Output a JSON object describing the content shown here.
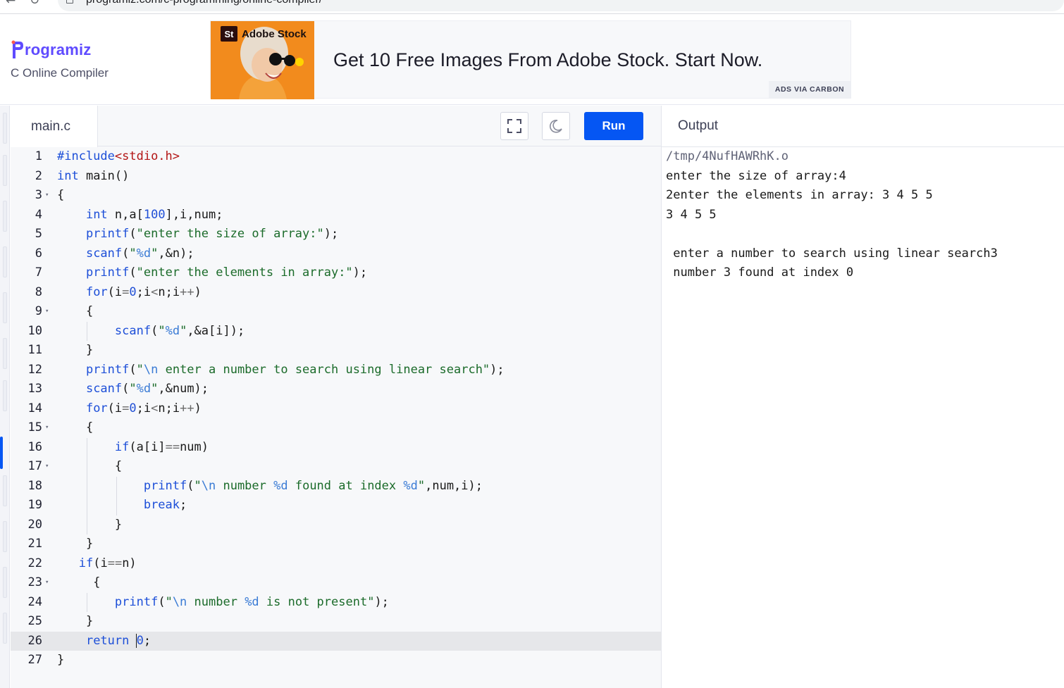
{
  "browser": {
    "url": "programiz.com/c-programming/online-compiler/"
  },
  "header": {
    "logo_text": "rogramiz",
    "subtitle": "C Online Compiler",
    "brand_color": "#5f4bff"
  },
  "ad": {
    "brand_badge": "St",
    "brand_name": "Adobe Stock",
    "headline": "Get 10 Free Images From Adobe Stock. Start Now.",
    "tag": "ADS VIA CARBON"
  },
  "editor": {
    "tab_label": "main.c",
    "fullscreen_icon": "fullscreen-icon",
    "theme_icon": "moon-icon",
    "run_label": "Run",
    "run_color": "#0556f3",
    "active_line": 26,
    "lines": [
      {
        "n": "1",
        "text": "#include<stdio.h>"
      },
      {
        "n": "2",
        "text": "int main()"
      },
      {
        "n": "3",
        "text": "{"
      },
      {
        "n": "4",
        "text": "    int n,a[100],i,num;"
      },
      {
        "n": "5",
        "text": "    printf(\"enter the size of array:\");"
      },
      {
        "n": "6",
        "text": "    scanf(\"%d\",&n);"
      },
      {
        "n": "7",
        "text": "    printf(\"enter the elements in array:\");"
      },
      {
        "n": "8",
        "text": "    for(i=0;i<n;i++)"
      },
      {
        "n": "9",
        "text": "    {"
      },
      {
        "n": "10",
        "text": "        scanf(\"%d\",&a[i]);"
      },
      {
        "n": "11",
        "text": "    }"
      },
      {
        "n": "12",
        "text": "    printf(\"\\n enter a number to search using linear search\");"
      },
      {
        "n": "13",
        "text": "    scanf(\"%d\",&num);"
      },
      {
        "n": "14",
        "text": "    for(i=0;i<n;i++)"
      },
      {
        "n": "15",
        "text": "    {"
      },
      {
        "n": "16",
        "text": "        if(a[i]==num)"
      },
      {
        "n": "17",
        "text": "        {"
      },
      {
        "n": "18",
        "text": "            printf(\"\\n number %d found at index %d\",num,i);"
      },
      {
        "n": "19",
        "text": "            break;"
      },
      {
        "n": "20",
        "text": "        }"
      },
      {
        "n": "21",
        "text": "    }"
      },
      {
        "n": "22",
        "text": "   if(i==n)"
      },
      {
        "n": "23",
        "text": "     {"
      },
      {
        "n": "24",
        "text": "        printf(\"\\n number %d is not present\");"
      },
      {
        "n": "25",
        "text": "    }"
      },
      {
        "n": "26",
        "text": "    return 0;"
      },
      {
        "n": "27",
        "text": "}"
      }
    ],
    "fold_lines": [
      "3",
      "9",
      "15",
      "17",
      "23"
    ]
  },
  "output": {
    "title": "Output",
    "lines": [
      "/tmp/4NufHAWRhK.o",
      "enter the size of array:4",
      "2enter the elements in array: 3 4 5 5",
      "3 4 5 5",
      "",
      " enter a number to search using linear search3",
      " number 3 found at index 0"
    ]
  }
}
